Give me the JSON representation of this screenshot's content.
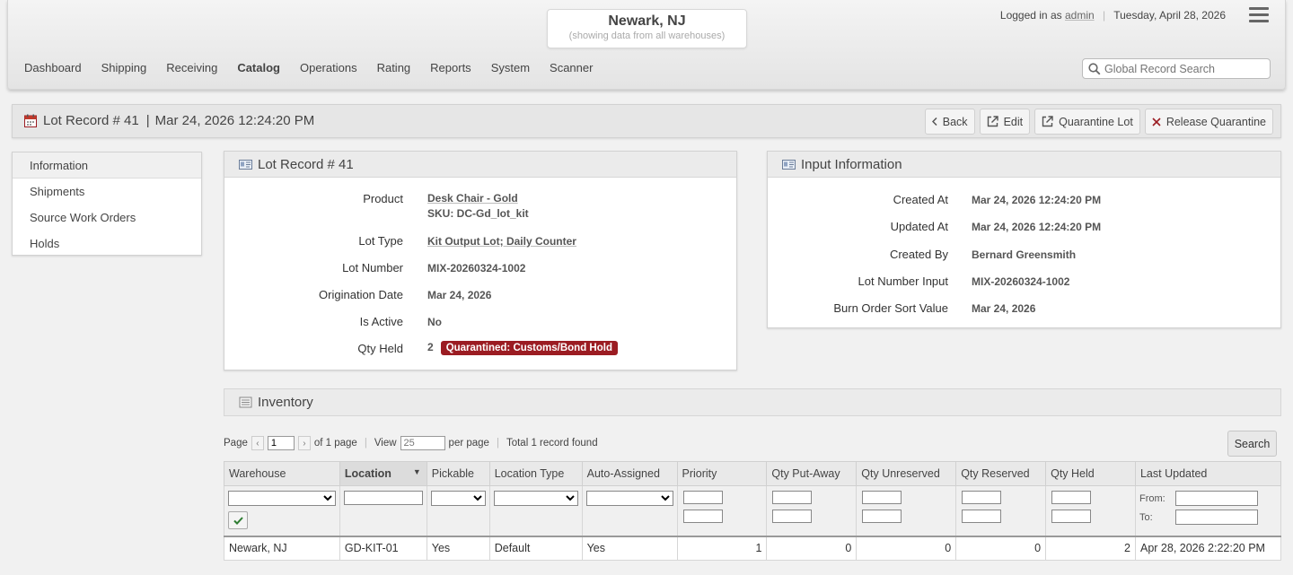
{
  "header": {
    "warehouse_name": "Newark, NJ",
    "warehouse_sub": "(showing data from all warehouses)",
    "logged_in_prefix": "Logged in as",
    "username": "admin",
    "date": "Tuesday, April 28, 2026",
    "nav": [
      "Dashboard",
      "Shipping",
      "Receiving",
      "Catalog",
      "Operations",
      "Rating",
      "Reports",
      "System",
      "Scanner"
    ],
    "active_nav": "Catalog",
    "search_placeholder": "Global Record Search"
  },
  "titlebar": {
    "record": "Lot Record #  41",
    "timestamp": "Mar 24, 2026 12:24:20 PM",
    "buttons": {
      "back": "Back",
      "edit": "Edit",
      "quarantine": "Quarantine Lot",
      "release": "Release Quarantine"
    }
  },
  "sidebar": {
    "items": [
      "Information",
      "Shipments",
      "Source Work Orders",
      "Holds"
    ]
  },
  "lot_panel": {
    "title": "Lot Record #  41",
    "product_label": "Product",
    "product_name": "Desk Chair - Gold",
    "product_sku": "SKU:  DC-Gd_lot_kit",
    "lot_type_label": "Lot Type",
    "lot_type": "Kit Output Lot; Daily Counter",
    "lot_number_label": "Lot Number",
    "lot_number": "MIX-20260324-1002",
    "origination_label": "Origination Date",
    "origination_date": "Mar 24, 2026",
    "active_label": "Is Active",
    "active_value": "No",
    "qty_held_label": "Qty Held",
    "qty_held": "2",
    "qty_held_badge": "Quarantined: Customs/Bond Hold"
  },
  "input_panel": {
    "title": "Input Information",
    "created_at_label": "Created At",
    "created_at": "Mar 24, 2026 12:24:20 PM",
    "updated_at_label": "Updated At",
    "updated_at": "Mar 24, 2026 12:24:20 PM",
    "created_by_label": "Created By",
    "created_by": "Bernard Greensmith",
    "lot_number_input_label": "Lot Number Input",
    "lot_number_input": "MIX-20260324-1002",
    "burn_order_label": "Burn Order Sort Value",
    "burn_order": "Mar 24, 2026"
  },
  "inventory": {
    "title": "Inventory",
    "pager": {
      "page_label": "Page",
      "page_value": "1",
      "of_pages": "of 1 page",
      "view_label": "View",
      "view_value": "25",
      "per_page": "per page",
      "total": "Total 1 record found"
    },
    "search_button": "Search",
    "columns": [
      "Warehouse",
      "Location",
      "Pickable",
      "Location Type",
      "Auto-Assigned",
      "Priority",
      "Qty Put-Away",
      "Qty Unreserved",
      "Qty Reserved",
      "Qty Held",
      "Last Updated"
    ],
    "sorted_column": "Location",
    "filter_from": "From:",
    "filter_to": "To:",
    "rows": [
      [
        "Newark, NJ",
        "GD-KIT-01",
        "Yes",
        "Default",
        "Yes",
        "1",
        "0",
        "0",
        "0",
        "2",
        "Apr 28, 2026 2:22:20 PM"
      ]
    ]
  },
  "colors": {
    "badge_bg": "#9b1c22",
    "header_bg": "#eaeaea",
    "page_bg": "#f1f1f1"
  }
}
